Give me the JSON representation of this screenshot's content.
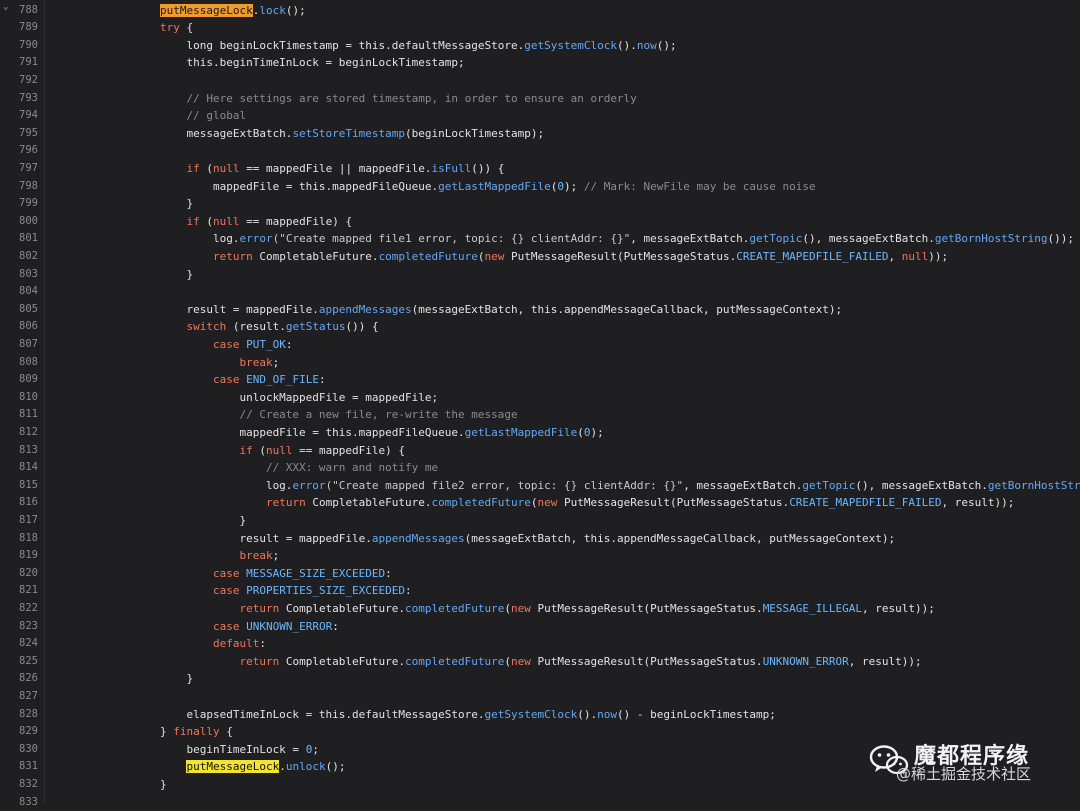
{
  "editor": {
    "fold_marker": "⌄",
    "lines": [
      {
        "no": "788",
        "tokens": [
          {
            "t": "        ",
            "c": ""
          },
          {
            "t": "putMessageLock",
            "c": "hl-orange"
          },
          {
            "t": ".",
            "c": ""
          },
          {
            "t": "lock",
            "c": "fn"
          },
          {
            "t": "();",
            "c": ""
          }
        ]
      },
      {
        "no": "789",
        "tokens": [
          {
            "t": "        ",
            "c": ""
          },
          {
            "t": "try",
            "c": "kw"
          },
          {
            "t": " {",
            "c": ""
          }
        ]
      },
      {
        "no": "790",
        "tokens": [
          {
            "t": "            long beginLockTimestamp = this.defaultMessageStore.",
            "c": ""
          },
          {
            "t": "getSystemClock",
            "c": "fn"
          },
          {
            "t": "().",
            "c": ""
          },
          {
            "t": "now",
            "c": "fn"
          },
          {
            "t": "();",
            "c": ""
          }
        ]
      },
      {
        "no": "791",
        "tokens": [
          {
            "t": "            this.beginTimeInLock = beginLockTimestamp;",
            "c": ""
          }
        ]
      },
      {
        "no": "792",
        "tokens": []
      },
      {
        "no": "793",
        "tokens": [
          {
            "t": "            // Here settings are stored timestamp, in order to ensure an orderly",
            "c": "cmt"
          }
        ]
      },
      {
        "no": "794",
        "tokens": [
          {
            "t": "            // global",
            "c": "cmt"
          }
        ]
      },
      {
        "no": "795",
        "tokens": [
          {
            "t": "            messageExtBatch.",
            "c": ""
          },
          {
            "t": "setStoreTimestamp",
            "c": "fn"
          },
          {
            "t": "(beginLockTimestamp);",
            "c": ""
          }
        ]
      },
      {
        "no": "796",
        "tokens": []
      },
      {
        "no": "797",
        "tokens": [
          {
            "t": "            ",
            "c": ""
          },
          {
            "t": "if",
            "c": "kw"
          },
          {
            "t": " (",
            "c": ""
          },
          {
            "t": "null",
            "c": "kw"
          },
          {
            "t": " == mappedFile || mappedFile.",
            "c": ""
          },
          {
            "t": "isFull",
            "c": "fn"
          },
          {
            "t": "()) {",
            "c": ""
          }
        ]
      },
      {
        "no": "798",
        "tokens": [
          {
            "t": "                mappedFile = this.mappedFileQueue.",
            "c": ""
          },
          {
            "t": "getLastMappedFile",
            "c": "fn"
          },
          {
            "t": "(",
            "c": ""
          },
          {
            "t": "0",
            "c": "num"
          },
          {
            "t": "); ",
            "c": ""
          },
          {
            "t": "// Mark: NewFile may be cause noise",
            "c": "cmt"
          }
        ]
      },
      {
        "no": "799",
        "tokens": [
          {
            "t": "            }",
            "c": ""
          }
        ]
      },
      {
        "no": "800",
        "tokens": [
          {
            "t": "            ",
            "c": ""
          },
          {
            "t": "if",
            "c": "kw"
          },
          {
            "t": " (",
            "c": ""
          },
          {
            "t": "null",
            "c": "kw"
          },
          {
            "t": " == mappedFile) {",
            "c": ""
          }
        ]
      },
      {
        "no": "801",
        "tokens": [
          {
            "t": "                log.",
            "c": ""
          },
          {
            "t": "error",
            "c": "fn"
          },
          {
            "t": "(\"Create mapped file1 error, topic: {} clientAddr: {}\"",
            "c": "str"
          },
          {
            "t": ", messageExtBatch.",
            "c": ""
          },
          {
            "t": "getTopic",
            "c": "fn"
          },
          {
            "t": "(), messageExtBatch.",
            "c": ""
          },
          {
            "t": "getBornHostString",
            "c": "fn"
          },
          {
            "t": "());",
            "c": ""
          }
        ]
      },
      {
        "no": "802",
        "tokens": [
          {
            "t": "                ",
            "c": ""
          },
          {
            "t": "return",
            "c": "kw"
          },
          {
            "t": " CompletableFuture.",
            "c": ""
          },
          {
            "t": "completedFuture",
            "c": "fn"
          },
          {
            "t": "(",
            "c": ""
          },
          {
            "t": "new",
            "c": "kw"
          },
          {
            "t": " PutMessageResult(PutMessageStatus.",
            "c": ""
          },
          {
            "t": "CREATE_MAPEDFILE_FAILED",
            "c": "cst"
          },
          {
            "t": ", ",
            "c": ""
          },
          {
            "t": "null",
            "c": "kw"
          },
          {
            "t": "));",
            "c": ""
          }
        ]
      },
      {
        "no": "803",
        "tokens": [
          {
            "t": "            }",
            "c": ""
          }
        ]
      },
      {
        "no": "804",
        "tokens": []
      },
      {
        "no": "805",
        "tokens": [
          {
            "t": "            result = mappedFile.",
            "c": ""
          },
          {
            "t": "appendMessages",
            "c": "fn"
          },
          {
            "t": "(messageExtBatch, this.appendMessageCallback, putMessageContext);",
            "c": ""
          }
        ]
      },
      {
        "no": "806",
        "tokens": [
          {
            "t": "            ",
            "c": ""
          },
          {
            "t": "switch",
            "c": "kw"
          },
          {
            "t": " (result.",
            "c": ""
          },
          {
            "t": "getStatus",
            "c": "fn"
          },
          {
            "t": "()) {",
            "c": ""
          }
        ]
      },
      {
        "no": "807",
        "tokens": [
          {
            "t": "                ",
            "c": ""
          },
          {
            "t": "case",
            "c": "kw"
          },
          {
            "t": " ",
            "c": ""
          },
          {
            "t": "PUT_OK",
            "c": "cst"
          },
          {
            "t": ":",
            "c": ""
          }
        ]
      },
      {
        "no": "808",
        "tokens": [
          {
            "t": "                    ",
            "c": ""
          },
          {
            "t": "break",
            "c": "kw"
          },
          {
            "t": ";",
            "c": ""
          }
        ]
      },
      {
        "no": "809",
        "tokens": [
          {
            "t": "                ",
            "c": ""
          },
          {
            "t": "case",
            "c": "kw"
          },
          {
            "t": " ",
            "c": ""
          },
          {
            "t": "END_OF_FILE",
            "c": "cst"
          },
          {
            "t": ":",
            "c": ""
          }
        ]
      },
      {
        "no": "810",
        "tokens": [
          {
            "t": "                    unlockMappedFile = mappedFile;",
            "c": ""
          }
        ]
      },
      {
        "no": "811",
        "tokens": [
          {
            "t": "                    // Create a new file, re-write the message",
            "c": "cmt"
          }
        ]
      },
      {
        "no": "812",
        "tokens": [
          {
            "t": "                    mappedFile = this.mappedFileQueue.",
            "c": ""
          },
          {
            "t": "getLastMappedFile",
            "c": "fn"
          },
          {
            "t": "(",
            "c": ""
          },
          {
            "t": "0",
            "c": "num"
          },
          {
            "t": ");",
            "c": ""
          }
        ]
      },
      {
        "no": "813",
        "tokens": [
          {
            "t": "                    ",
            "c": ""
          },
          {
            "t": "if",
            "c": "kw"
          },
          {
            "t": " (",
            "c": ""
          },
          {
            "t": "null",
            "c": "kw"
          },
          {
            "t": " == mappedFile) {",
            "c": ""
          }
        ]
      },
      {
        "no": "814",
        "tokens": [
          {
            "t": "                        // XXX: warn and notify me",
            "c": "cmt"
          }
        ]
      },
      {
        "no": "815",
        "tokens": [
          {
            "t": "                        log.",
            "c": ""
          },
          {
            "t": "error",
            "c": "fn"
          },
          {
            "t": "(\"Create mapped file2 error, topic: {} clientAddr: {}\"",
            "c": "str"
          },
          {
            "t": ", messageExtBatch.",
            "c": ""
          },
          {
            "t": "getTopic",
            "c": "fn"
          },
          {
            "t": "(), messageExtBatch.",
            "c": ""
          },
          {
            "t": "getBornHostString",
            "c": "fn"
          },
          {
            "t": "());",
            "c": ""
          }
        ]
      },
      {
        "no": "816",
        "tokens": [
          {
            "t": "                        ",
            "c": ""
          },
          {
            "t": "return",
            "c": "kw"
          },
          {
            "t": " CompletableFuture.",
            "c": ""
          },
          {
            "t": "completedFuture",
            "c": "fn"
          },
          {
            "t": "(",
            "c": ""
          },
          {
            "t": "new",
            "c": "kw"
          },
          {
            "t": " PutMessageResult(PutMessageStatus.",
            "c": ""
          },
          {
            "t": "CREATE_MAPEDFILE_FAILED",
            "c": "cst"
          },
          {
            "t": ", result));",
            "c": ""
          }
        ]
      },
      {
        "no": "817",
        "tokens": [
          {
            "t": "                    }",
            "c": ""
          }
        ]
      },
      {
        "no": "818",
        "tokens": [
          {
            "t": "                    result = mappedFile.",
            "c": ""
          },
          {
            "t": "appendMessages",
            "c": "fn"
          },
          {
            "t": "(messageExtBatch, this.appendMessageCallback, putMessageContext);",
            "c": ""
          }
        ]
      },
      {
        "no": "819",
        "tokens": [
          {
            "t": "                    ",
            "c": ""
          },
          {
            "t": "break",
            "c": "kw"
          },
          {
            "t": ";",
            "c": ""
          }
        ]
      },
      {
        "no": "820",
        "tokens": [
          {
            "t": "                ",
            "c": ""
          },
          {
            "t": "case",
            "c": "kw"
          },
          {
            "t": " ",
            "c": ""
          },
          {
            "t": "MESSAGE_SIZE_EXCEEDED",
            "c": "cst"
          },
          {
            "t": ":",
            "c": ""
          }
        ]
      },
      {
        "no": "821",
        "tokens": [
          {
            "t": "                ",
            "c": ""
          },
          {
            "t": "case",
            "c": "kw"
          },
          {
            "t": " ",
            "c": ""
          },
          {
            "t": "PROPERTIES_SIZE_EXCEEDED",
            "c": "cst"
          },
          {
            "t": ":",
            "c": ""
          }
        ]
      },
      {
        "no": "822",
        "tokens": [
          {
            "t": "                    ",
            "c": ""
          },
          {
            "t": "return",
            "c": "kw"
          },
          {
            "t": " CompletableFuture.",
            "c": ""
          },
          {
            "t": "completedFuture",
            "c": "fn"
          },
          {
            "t": "(",
            "c": ""
          },
          {
            "t": "new",
            "c": "kw"
          },
          {
            "t": " PutMessageResult(PutMessageStatus.",
            "c": ""
          },
          {
            "t": "MESSAGE_ILLEGAL",
            "c": "cst"
          },
          {
            "t": ", result));",
            "c": ""
          }
        ]
      },
      {
        "no": "823",
        "tokens": [
          {
            "t": "                ",
            "c": ""
          },
          {
            "t": "case",
            "c": "kw"
          },
          {
            "t": " ",
            "c": ""
          },
          {
            "t": "UNKNOWN_ERROR",
            "c": "cst"
          },
          {
            "t": ":",
            "c": ""
          }
        ]
      },
      {
        "no": "824",
        "tokens": [
          {
            "t": "                ",
            "c": ""
          },
          {
            "t": "default",
            "c": "kw"
          },
          {
            "t": ":",
            "c": ""
          }
        ]
      },
      {
        "no": "825",
        "tokens": [
          {
            "t": "                    ",
            "c": ""
          },
          {
            "t": "return",
            "c": "kw"
          },
          {
            "t": " CompletableFuture.",
            "c": ""
          },
          {
            "t": "completedFuture",
            "c": "fn"
          },
          {
            "t": "(",
            "c": ""
          },
          {
            "t": "new",
            "c": "kw"
          },
          {
            "t": " PutMessageResult(PutMessageStatus.",
            "c": ""
          },
          {
            "t": "UNKNOWN_ERROR",
            "c": "cst"
          },
          {
            "t": ", result));",
            "c": ""
          }
        ]
      },
      {
        "no": "826",
        "tokens": [
          {
            "t": "            }",
            "c": ""
          }
        ]
      },
      {
        "no": "827",
        "tokens": []
      },
      {
        "no": "828",
        "tokens": [
          {
            "t": "            elapsedTimeInLock = this.defaultMessageStore.",
            "c": ""
          },
          {
            "t": "getSystemClock",
            "c": "fn"
          },
          {
            "t": "().",
            "c": ""
          },
          {
            "t": "now",
            "c": "fn"
          },
          {
            "t": "() - beginLockTimestamp;",
            "c": ""
          }
        ]
      },
      {
        "no": "829",
        "tokens": [
          {
            "t": "        } ",
            "c": ""
          },
          {
            "t": "finally",
            "c": "kw"
          },
          {
            "t": " {",
            "c": ""
          }
        ]
      },
      {
        "no": "830",
        "tokens": [
          {
            "t": "            beginTimeInLock = ",
            "c": ""
          },
          {
            "t": "0",
            "c": "num"
          },
          {
            "t": ";",
            "c": ""
          }
        ]
      },
      {
        "no": "831",
        "tokens": [
          {
            "t": "            ",
            "c": ""
          },
          {
            "t": "putMessageLock",
            "c": "hl-yellow"
          },
          {
            "t": ".",
            "c": ""
          },
          {
            "t": "unlock",
            "c": "fn"
          },
          {
            "t": "();",
            "c": ""
          }
        ]
      },
      {
        "no": "832",
        "tokens": [
          {
            "t": "        }",
            "c": ""
          }
        ]
      },
      {
        "no": "833",
        "tokens": []
      }
    ]
  },
  "watermark": {
    "title": "魔都程序缘",
    "subtitle": "@稀土掘金技术社区",
    "icon": "wechat-icon"
  }
}
